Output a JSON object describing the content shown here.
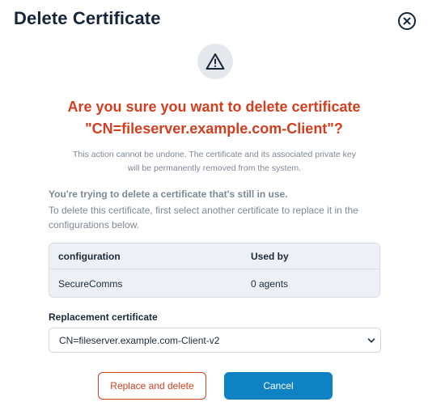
{
  "dialog": {
    "title": "Delete Certificate",
    "close_icon": "close-circle-icon",
    "warning_icon": "warning-triangle-icon"
  },
  "question": {
    "line1": "Are you sure you want to delete certificate",
    "line2": "\"CN=fileserver.example.com-Client\"?"
  },
  "note": {
    "line1": "This action cannot be undone. The certificate and its associated private key",
    "line2": "will be permanently removed from the system."
  },
  "in_use": {
    "heading": "You're trying to delete a certificate that's still in use.",
    "description": "To delete this certificate, first select another certificate to replace it in the configurations below."
  },
  "config_table": {
    "headers": [
      "configuration",
      "Used by"
    ],
    "rows": [
      [
        "SecureComms",
        "0 agents"
      ]
    ]
  },
  "replacement": {
    "label": "Replacement certificate",
    "selected": "CN=fileserver.example.com-Client-v2"
  },
  "buttons": {
    "replace_label": "Replace and delete",
    "cancel_label": "Cancel"
  },
  "colors": {
    "danger": "#d23f1f",
    "primary": "#0f82c4",
    "title": "#15263a",
    "muted": "#7d8894"
  }
}
